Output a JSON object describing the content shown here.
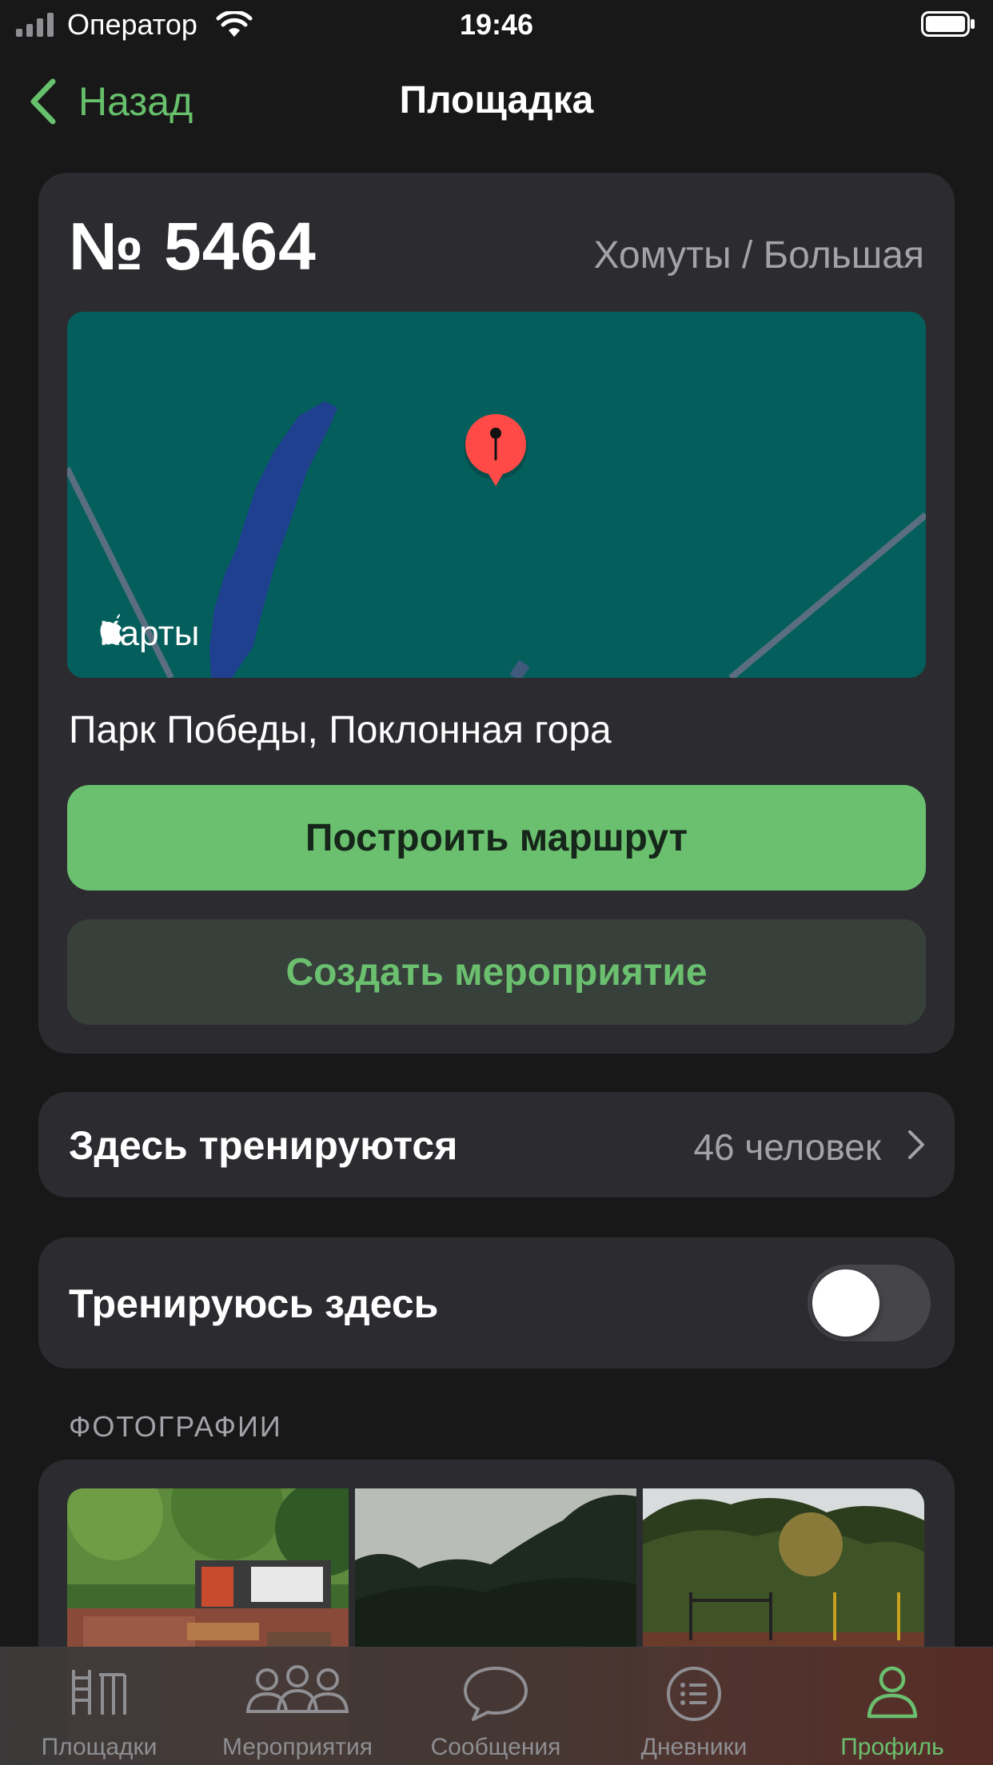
{
  "status_bar": {
    "carrier": "Оператор",
    "time": "19:46"
  },
  "nav": {
    "back_label": "Назад",
    "title": "Площадка"
  },
  "ground": {
    "number": "№ 5464",
    "type": "Хомуты / Большая",
    "maps_brand": "Карты",
    "address": "Парк Победы, Поклонная гора",
    "route_button": "Построить маршрут",
    "create_event_button": "Создать мероприятие"
  },
  "trainers": {
    "label": "Здесь тренируются",
    "count": "46 человек"
  },
  "training_here": {
    "label": "Тренируюсь здесь",
    "enabled": false
  },
  "photos": {
    "header": "ФОТОГРАФИИ",
    "items": [
      "photo-playground",
      "photo-trees-sky",
      "photo-park-equipment"
    ]
  },
  "tab_bar": {
    "active": "profile",
    "tabs": [
      {
        "id": "grounds",
        "label": "Площадки",
        "icon": "ladder-icon"
      },
      {
        "id": "events",
        "label": "Мероприятия",
        "icon": "people-icon"
      },
      {
        "id": "messages",
        "label": "Сообщения",
        "icon": "speech-bubble-icon"
      },
      {
        "id": "diaries",
        "label": "Дневники",
        "icon": "list-icon"
      },
      {
        "id": "profile",
        "label": "Профиль",
        "icon": "person-icon"
      }
    ]
  },
  "colors": {
    "accent": "#6bc06f",
    "background": "#181818",
    "card": "#2c2c30",
    "map_background": "#045f5c",
    "pin": "#ff4a47"
  }
}
